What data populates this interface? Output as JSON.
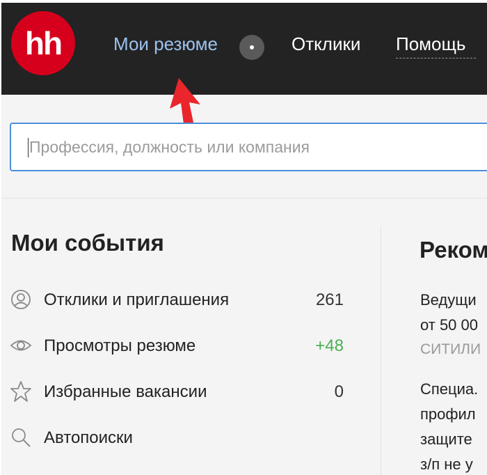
{
  "header": {
    "logo_text": "hh",
    "nav": {
      "resume": "Мои резюме",
      "responses": "Отклики",
      "help": "Помощь"
    }
  },
  "search": {
    "placeholder": "Профессия, должность или компания"
  },
  "events": {
    "title": "Мои события",
    "items": [
      {
        "icon": "person-circle-icon",
        "label": "Отклики и приглашения",
        "count": "261"
      },
      {
        "icon": "eye-icon",
        "label": "Просмотры резюме",
        "count": "+48"
      },
      {
        "icon": "star-icon",
        "label": "Избранные вакансии",
        "count": "0"
      },
      {
        "icon": "search-icon",
        "label": "Автопоиски",
        "count": ""
      }
    ]
  },
  "recommendations": {
    "title": "Реком",
    "lines": [
      "Ведущи",
      "от 50 00",
      "СИТИЛИ",
      "Специа.",
      "профил",
      "защите",
      "з/п не у"
    ]
  },
  "colors": {
    "header_bg": "#232323",
    "logo_red": "#d6001c",
    "nav_active": "#9cc2ee",
    "accent_blue": "#4a90d9",
    "positive_green": "#4caf50",
    "annotation_red": "#e8262c"
  }
}
